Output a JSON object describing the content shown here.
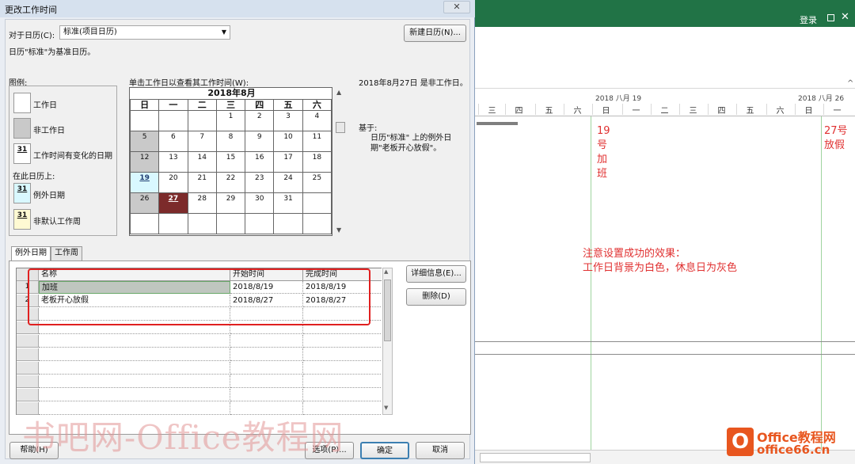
{
  "dialog": {
    "title": "更改工作时间",
    "close": "✕",
    "for_calendar_label": "对于日历(C):",
    "calendar_value": "标准(项目日历)",
    "new_calendar_button": "新建日历(N)...",
    "base_note": "日历\"标准\"为基准日历。",
    "legend_title": "图例:",
    "legend": {
      "working": "工作日",
      "nonworking": "非工作日",
      "edited": "工作时间有变化的日期",
      "on_this_calendar": "在此日历上:",
      "exception": "例外日期",
      "nondefault": "非默认工作周",
      "swatch_day": "31"
    },
    "click_hint": "单击工作日以查看其工作时间(W):",
    "info_date": "2018年8月27日 是非工作日。",
    "info_based": "基于:",
    "info_desc": "日历\"标准\" 上的例外日期\"老板开心放假\"。",
    "tabs": [
      "例外日期",
      "工作周"
    ],
    "detail_button": "详细信息(E)...",
    "delete_button": "删除(D)",
    "help_button": "帮助(H)",
    "options_button": "选项(P)...",
    "ok_button": "确定",
    "cancel_button": "取消"
  },
  "calendar": {
    "month_title": "2018年8月",
    "weekdays": [
      "日",
      "一",
      "二",
      "三",
      "四",
      "五",
      "六"
    ],
    "weeks": [
      [
        {
          "d": "",
          "c": "blank"
        },
        {
          "d": "",
          "c": "blank"
        },
        {
          "d": "",
          "c": "blank"
        },
        {
          "d": "1",
          "c": "work"
        },
        {
          "d": "2",
          "c": "work"
        },
        {
          "d": "3",
          "c": "work"
        },
        {
          "d": "4",
          "c": "work"
        }
      ],
      [
        {
          "d": "5",
          "c": "off"
        },
        {
          "d": "6",
          "c": "work"
        },
        {
          "d": "7",
          "c": "work"
        },
        {
          "d": "8",
          "c": "work"
        },
        {
          "d": "9",
          "c": "work"
        },
        {
          "d": "10",
          "c": "work"
        },
        {
          "d": "11",
          "c": "work"
        }
      ],
      [
        {
          "d": "12",
          "c": "off"
        },
        {
          "d": "13",
          "c": "work"
        },
        {
          "d": "14",
          "c": "work"
        },
        {
          "d": "15",
          "c": "work"
        },
        {
          "d": "16",
          "c": "work"
        },
        {
          "d": "17",
          "c": "work"
        },
        {
          "d": "18",
          "c": "work"
        }
      ],
      [
        {
          "d": "19",
          "c": "exc"
        },
        {
          "d": "20",
          "c": "work"
        },
        {
          "d": "21",
          "c": "work"
        },
        {
          "d": "22",
          "c": "work"
        },
        {
          "d": "23",
          "c": "work"
        },
        {
          "d": "24",
          "c": "work"
        },
        {
          "d": "25",
          "c": "work"
        }
      ],
      [
        {
          "d": "26",
          "c": "off"
        },
        {
          "d": "27",
          "c": "sel"
        },
        {
          "d": "28",
          "c": "work"
        },
        {
          "d": "29",
          "c": "work"
        },
        {
          "d": "30",
          "c": "work"
        },
        {
          "d": "31",
          "c": "work"
        },
        {
          "d": "",
          "c": "blank"
        }
      ],
      [
        {
          "d": "",
          "c": "blank"
        },
        {
          "d": "",
          "c": "blank"
        },
        {
          "d": "",
          "c": "blank"
        },
        {
          "d": "",
          "c": "blank"
        },
        {
          "d": "",
          "c": "blank"
        },
        {
          "d": "",
          "c": "blank"
        },
        {
          "d": "",
          "c": "blank"
        }
      ]
    ]
  },
  "exceptions": {
    "columns": [
      "名称",
      "开始时间",
      "完成时间"
    ],
    "rows": [
      {
        "num": "1",
        "name": "加班",
        "start": "2018/8/19",
        "end": "2018/8/19"
      },
      {
        "num": "2",
        "name": "老板开心放假",
        "start": "2018/8/27",
        "end": "2018/8/27"
      }
    ],
    "empty_rows": 8
  },
  "background": {
    "login": "登录",
    "collapse": "^",
    "week1_label": "2018 八月 19",
    "week2_label": "2018 八月 26",
    "days": [
      "三",
      "四",
      "五",
      "六",
      "日",
      "一",
      "二",
      "三",
      "四",
      "五",
      "六",
      "日",
      "一"
    ],
    "note_19": [
      "19",
      "号",
      "加",
      "班"
    ],
    "note_27": [
      "27号",
      "放假"
    ],
    "annotation": [
      "注意设置成功的效果：",
      "工作日背景为白色，休息日为灰色"
    ]
  },
  "watermark": "书吧网-Office教程网",
  "logo": {
    "line1": "Office教程网",
    "line2": "office66.cn"
  },
  "colors": {
    "ribbon": "#217346",
    "selected_day": "#7c2b2b",
    "exception_day": "#d9f8ff",
    "nonworking_day": "#c9c9c9",
    "highlight": "#e02020"
  }
}
